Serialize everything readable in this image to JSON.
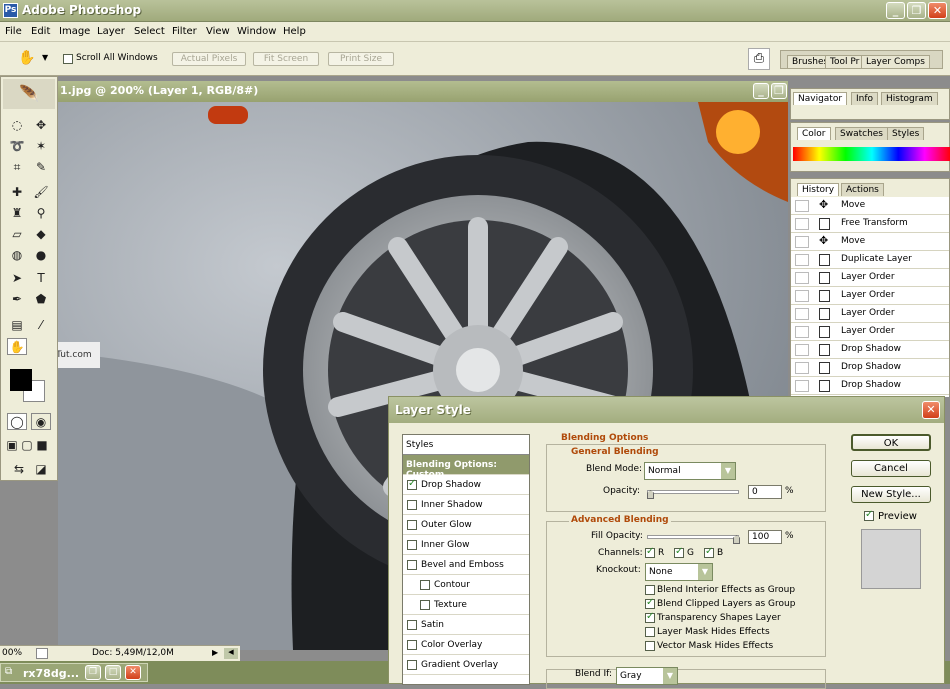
{
  "app": {
    "title": "Adobe Photoshop",
    "icon_label": "Ps"
  },
  "menu": [
    "File",
    "Edit",
    "Image",
    "Layer",
    "Select",
    "Filter",
    "View",
    "Window",
    "Help"
  ],
  "options": {
    "scroll_all": "Scroll All Windows",
    "actual_pixels": "Actual Pixels",
    "fit_screen": "Fit Screen",
    "print_size": "Print Size",
    "well_tabs": [
      "Brushes",
      "Tool Pr",
      "Layer Comps"
    ]
  },
  "document": {
    "title": "1.jpg @ 200% (Layer 1, RGB/8#)",
    "zoom": "00%",
    "doc_size": "Doc: 5,49M/12,0M",
    "watermark": "TechTut.com"
  },
  "taskbar": {
    "item": "rx78dg..."
  },
  "palettes": {
    "navigator_tabs": [
      "Navigator",
      "Info",
      "Histogram"
    ],
    "color_tabs": [
      "Color",
      "Swatches",
      "Styles"
    ],
    "history_tabs": [
      "History",
      "Actions"
    ],
    "history": [
      "Move",
      "Free Transform",
      "Move",
      "Duplicate Layer",
      "Layer Order",
      "Layer Order",
      "Layer Order",
      "Layer Order",
      "Drop Shadow",
      "Drop Shadow",
      "Drop Shadow"
    ]
  },
  "dialog": {
    "title": "Layer Style",
    "styles_header": "Styles",
    "styles": [
      {
        "label": "Blending Options: Custom",
        "checkbox": false,
        "selected": true
      },
      {
        "label": "Drop Shadow",
        "checkbox": true,
        "checked": true
      },
      {
        "label": "Inner Shadow",
        "checkbox": true,
        "checked": false
      },
      {
        "label": "Outer Glow",
        "checkbox": true,
        "checked": false
      },
      {
        "label": "Inner Glow",
        "checkbox": true,
        "checked": false
      },
      {
        "label": "Bevel and Emboss",
        "checkbox": true,
        "checked": false
      },
      {
        "label": "Contour",
        "checkbox": true,
        "checked": false,
        "indent": true
      },
      {
        "label": "Texture",
        "checkbox": true,
        "checked": false,
        "indent": true
      },
      {
        "label": "Satin",
        "checkbox": true,
        "checked": false
      },
      {
        "label": "Color Overlay",
        "checkbox": true,
        "checked": false
      },
      {
        "label": "Gradient Overlay",
        "checkbox": true,
        "checked": false
      }
    ],
    "blending_options": "Blending Options",
    "general_blending": "General Blending",
    "blend_mode_label": "Blend Mode:",
    "blend_mode": "Normal",
    "opacity_label": "Opacity:",
    "opacity": "0",
    "opacity_fraction": 0.0,
    "percent": "%",
    "advanced_blending": "Advanced Blending",
    "fill_opacity_label": "Fill Opacity:",
    "fill_opacity": "100",
    "fill_fraction": 1.0,
    "channels_label": "Channels:",
    "channels": [
      "R",
      "G",
      "B"
    ],
    "knockout_label": "Knockout:",
    "knockout": "None",
    "options": [
      {
        "label": "Blend Interior Effects as Group",
        "checked": false
      },
      {
        "label": "Blend Clipped Layers as Group",
        "checked": true
      },
      {
        "label": "Transparency Shapes Layer",
        "checked": true
      },
      {
        "label": "Layer Mask Hides Effects",
        "checked": false
      },
      {
        "label": "Vector Mask Hides Effects",
        "checked": false
      }
    ],
    "blend_if_label": "Blend If:",
    "blend_if": "Gray",
    "ok": "OK",
    "cancel": "Cancel",
    "new_style": "New Style...",
    "preview": "Preview"
  }
}
